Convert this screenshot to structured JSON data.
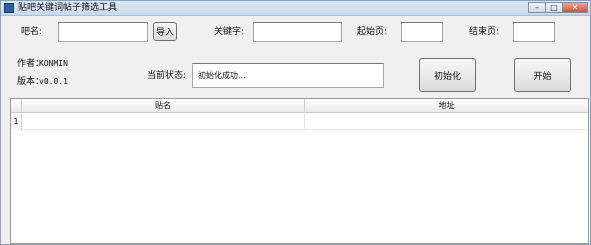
{
  "window": {
    "title": "贴吧关键词帖子筛选工具",
    "controls": {
      "minimize": "–",
      "maximize": "□",
      "close": "✕"
    }
  },
  "form": {
    "bar_name_label": "吧名:",
    "bar_name_value": "",
    "import_button": "导入",
    "keyword_label": "关键字:",
    "keyword_value": "",
    "start_page_label": "起始页:",
    "start_page_value": "",
    "end_page_label": "结束页:",
    "end_page_value": ""
  },
  "info": {
    "author_label": "作者：",
    "author_value": "KONMIN",
    "version_label": "版本：",
    "version_value": "v0.0.1",
    "status_label": "当前状态:",
    "status_value": "初始化成功..."
  },
  "actions": {
    "init_button": "初始化",
    "start_button": "开始"
  },
  "table": {
    "columns": [
      "贴名",
      "地址"
    ],
    "rows": [
      {
        "index": "1",
        "title": "",
        "url": ""
      }
    ]
  }
}
